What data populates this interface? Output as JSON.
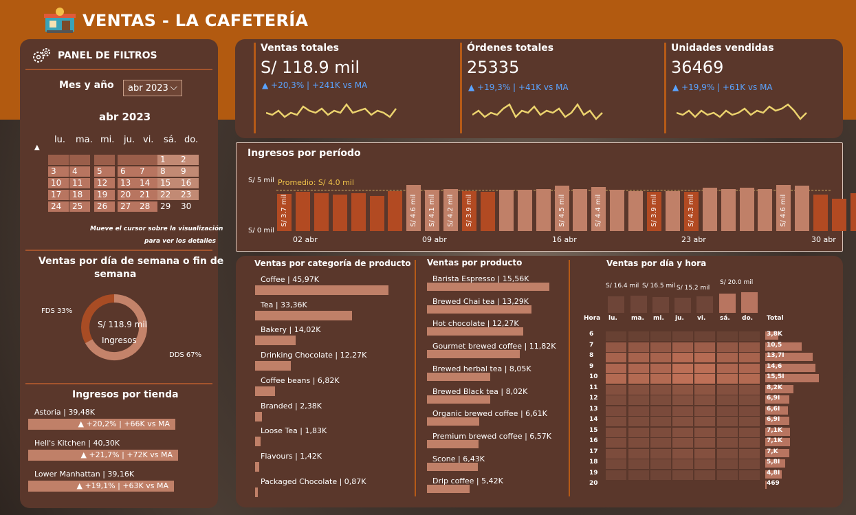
{
  "header": {
    "title": "VENTAS  - LA CAFETERÍA",
    "logo_icon": "coffee-shop-icon"
  },
  "filters": {
    "title": "PANEL DE FILTROS",
    "icon": "gears-icon",
    "month_label": "Mes y año",
    "month_value": "abr 2023",
    "calendar_title": "abr 2023",
    "weekdays": [
      "lu.",
      "ma.",
      "mi.",
      "ju.",
      "vi.",
      "sá.",
      "do."
    ],
    "weeks": [
      [
        "",
        "",
        "",
        "",
        "",
        "1",
        "2"
      ],
      [
        "3",
        "4",
        "5",
        "6",
        "7",
        "8",
        "9"
      ],
      [
        "10",
        "11",
        "12",
        "13",
        "14",
        "15",
        "16"
      ],
      [
        "17",
        "18",
        "19",
        "20",
        "21",
        "22",
        "23"
      ],
      [
        "24",
        "25",
        "26",
        "27",
        "28",
        "29",
        "30"
      ]
    ],
    "hint1": "Mueve el cursor sobre la visualización",
    "hint2": "para ver los detalles"
  },
  "weekday_panel": {
    "title1": "Ventas por día de semana o fin de",
    "title2": "semana",
    "center_value": "S/ 118.9 mil",
    "center_label": "Ingresos",
    "fds_label": "FDS 33%",
    "dds_label": "DDS 67%",
    "fds_fraction": 0.33
  },
  "stores": {
    "title": "Ingresos por tienda",
    "items": [
      {
        "name": "Astoria | 39,48K",
        "delta": "▲ +20,2% | +66K vs MA",
        "value": 39.48
      },
      {
        "name": "Hell's Kitchen | 40,30K",
        "delta": "▲ +21,7% | +72K vs MA",
        "value": 40.3
      },
      {
        "name": "Lower Manhattan | 39,16K",
        "delta": "▲ +19,1% | +63K vs MA",
        "value": 39.16
      }
    ]
  },
  "kpis": [
    {
      "label": "Ventas totales",
      "value": "S/ 118.9 mil",
      "delta": "▲ +20,3% | +241K vs MA"
    },
    {
      "label": "Órdenes totales",
      "value": "25335",
      "delta": "▲ +19,3% | +41K vs MA"
    },
    {
      "label": "Unidades vendidas",
      "value": "36469",
      "delta": "▲ +19,9% | +61K vs MA"
    }
  ],
  "period": {
    "title": "Ingresos por período",
    "y_top": "S/ 5 mil",
    "y_bottom": "S/ 0 mil",
    "avg_label": "Promedio: S/ 4.0 mil",
    "x_labels": [
      "02 abr",
      "09 abr",
      "16 abr",
      "23 abr",
      "30 abr"
    ],
    "bar_labels": [
      "S/ 3.7 mil",
      "S/ 4.6 mil",
      "S/ 4.1 mil",
      "S/ 4.2 mil",
      "S/ 3.9 mil",
      "S/ 4.5 mil",
      "S/ 4.4 mil",
      "S/ 3.9 mil",
      "S/ 4.3 mil",
      "S/ 4.6 mil"
    ]
  },
  "categories": {
    "title": "Ventas por categoría de producto",
    "items": [
      {
        "label": "Coffee | 45,97K",
        "value": 45.97
      },
      {
        "label": "Tea | 33,36K",
        "value": 33.36
      },
      {
        "label": "Bakery | 14,02K",
        "value": 14.02
      },
      {
        "label": "Drinking Chocolate | 12,27K",
        "value": 12.27
      },
      {
        "label": "Coffee beans | 6,82K",
        "value": 6.82
      },
      {
        "label": "Branded | 2,38K",
        "value": 2.38
      },
      {
        "label": "Loose Tea | 1,83K",
        "value": 1.83
      },
      {
        "label": "Flavours | 1,42K",
        "value": 1.42
      },
      {
        "label": "Packaged Chocolate | 0,87K",
        "value": 0.87
      }
    ]
  },
  "products": {
    "title": "Ventas por producto",
    "items": [
      {
        "label": "Barista Espresso | 15,56K",
        "value": 15.56
      },
      {
        "label": "Brewed Chai tea | 13,29K",
        "value": 13.29
      },
      {
        "label": "Hot chocolate | 12,27K",
        "value": 12.27
      },
      {
        "label": "Gourmet brewed coffee | 11,82K",
        "value": 11.82
      },
      {
        "label": "Brewed herbal tea | 8,05K",
        "value": 8.05
      },
      {
        "label": "Brewed Black tea | 8,02K",
        "value": 8.02
      },
      {
        "label": "Organic brewed coffee | 6,61K",
        "value": 6.61
      },
      {
        "label": "Premium brewed coffee | 6,57K",
        "value": 6.57
      },
      {
        "label": "Scone | 6,43K",
        "value": 6.43
      },
      {
        "label": "Drip coffee | 5,42K",
        "value": 5.42
      }
    ]
  },
  "heatmap": {
    "title": "Ventas por día y hora",
    "day_values": [
      "S/ 16.4 mil",
      "S/ 16.5 mil",
      "S/ 15.2 mil",
      "S/ 20.0 mil"
    ],
    "days": [
      "lu.",
      "ma.",
      "mi.",
      "ju.",
      "vi.",
      "sá.",
      "do."
    ],
    "hour_header": "Hora",
    "total_header": "Total",
    "hours": [
      "6",
      "7",
      "8",
      "9",
      "10",
      "11",
      "12",
      "13",
      "14",
      "15",
      "16",
      "17",
      "18",
      "19",
      "20"
    ],
    "totals": [
      "3,8K",
      "10,5",
      "13,7I",
      "14,6",
      "15,5I",
      "8,2K",
      "6,9I",
      "6,6I",
      "6,9I",
      "7,1K",
      "7,1K",
      "7,K",
      "5,8I",
      "4,8I",
      "469"
    ],
    "total_values": [
      3.8,
      10.5,
      13.7,
      14.6,
      15.5,
      8.2,
      6.9,
      6.6,
      6.9,
      7.1,
      7.1,
      7.0,
      5.8,
      4.8,
      0.47
    ]
  }
}
